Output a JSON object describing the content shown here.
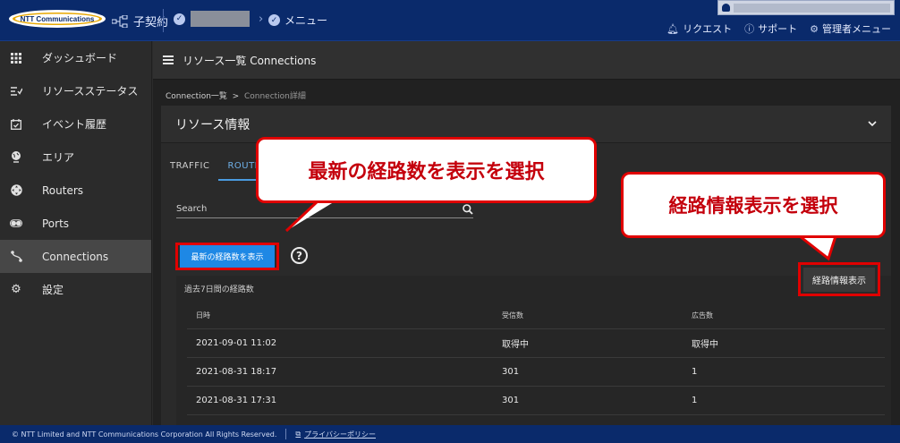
{
  "header": {
    "logo_text": "NTT Communications",
    "org_label": "子契約",
    "crumb_current": "メニュー",
    "links": [
      {
        "icon": "bell-icon",
        "label": "リクエスト"
      },
      {
        "icon": "help-circle-icon",
        "label": "サポート"
      },
      {
        "icon": "gear-icon",
        "label": "管理者メニュー"
      }
    ]
  },
  "sidebar": {
    "items": [
      {
        "icon": "grid-icon",
        "label": "ダッシュボード"
      },
      {
        "icon": "status-list-icon",
        "label": "リソースステータス"
      },
      {
        "icon": "calendar-check-icon",
        "label": "イベント履歴"
      },
      {
        "icon": "globe-pin-icon",
        "label": "エリア"
      },
      {
        "icon": "router-icon",
        "label": "Routers"
      },
      {
        "icon": "port-icon",
        "label": "Ports"
      },
      {
        "icon": "connection-icon",
        "label": "Connections"
      },
      {
        "icon": "gear-icon",
        "label": "設定"
      }
    ],
    "active_index": 6
  },
  "main": {
    "title": "リソース一覧 Connections",
    "breadcrumb": {
      "parent": "Connection一覧",
      "separator": ">",
      "current": "Connection詳細"
    },
    "card_title": "リソース情報",
    "tabs": [
      {
        "label": "TRAFFIC"
      },
      {
        "label": "ROUTE"
      }
    ],
    "active_tab": 1,
    "search_label": "Search",
    "latest_button": "最新の経路数を表示",
    "help_symbol": "?",
    "route_info_button": "経路情報表示",
    "route_panel_title": "過去7日間の経路数",
    "table": {
      "headers": [
        "日時",
        "受信数",
        "広告数"
      ],
      "rows": [
        [
          "2021-09-01 11:02",
          "取得中",
          "取得中"
        ],
        [
          "2021-08-31 18:17",
          "301",
          "1"
        ],
        [
          "2021-08-31 17:31",
          "301",
          "1"
        ]
      ]
    }
  },
  "callouts": {
    "latest": "最新の経路数を表示を選択",
    "route_info": "経路情報表示を選択"
  },
  "footer": {
    "copyright": "© NTT Limited and NTT Communications Corporation All Rights Reserved.",
    "privacy": "プライバシーポリシー"
  },
  "colors": {
    "header_bg": "#0a2a6b",
    "accent_blue": "#1e88e5",
    "highlight_red": "#e00000"
  }
}
